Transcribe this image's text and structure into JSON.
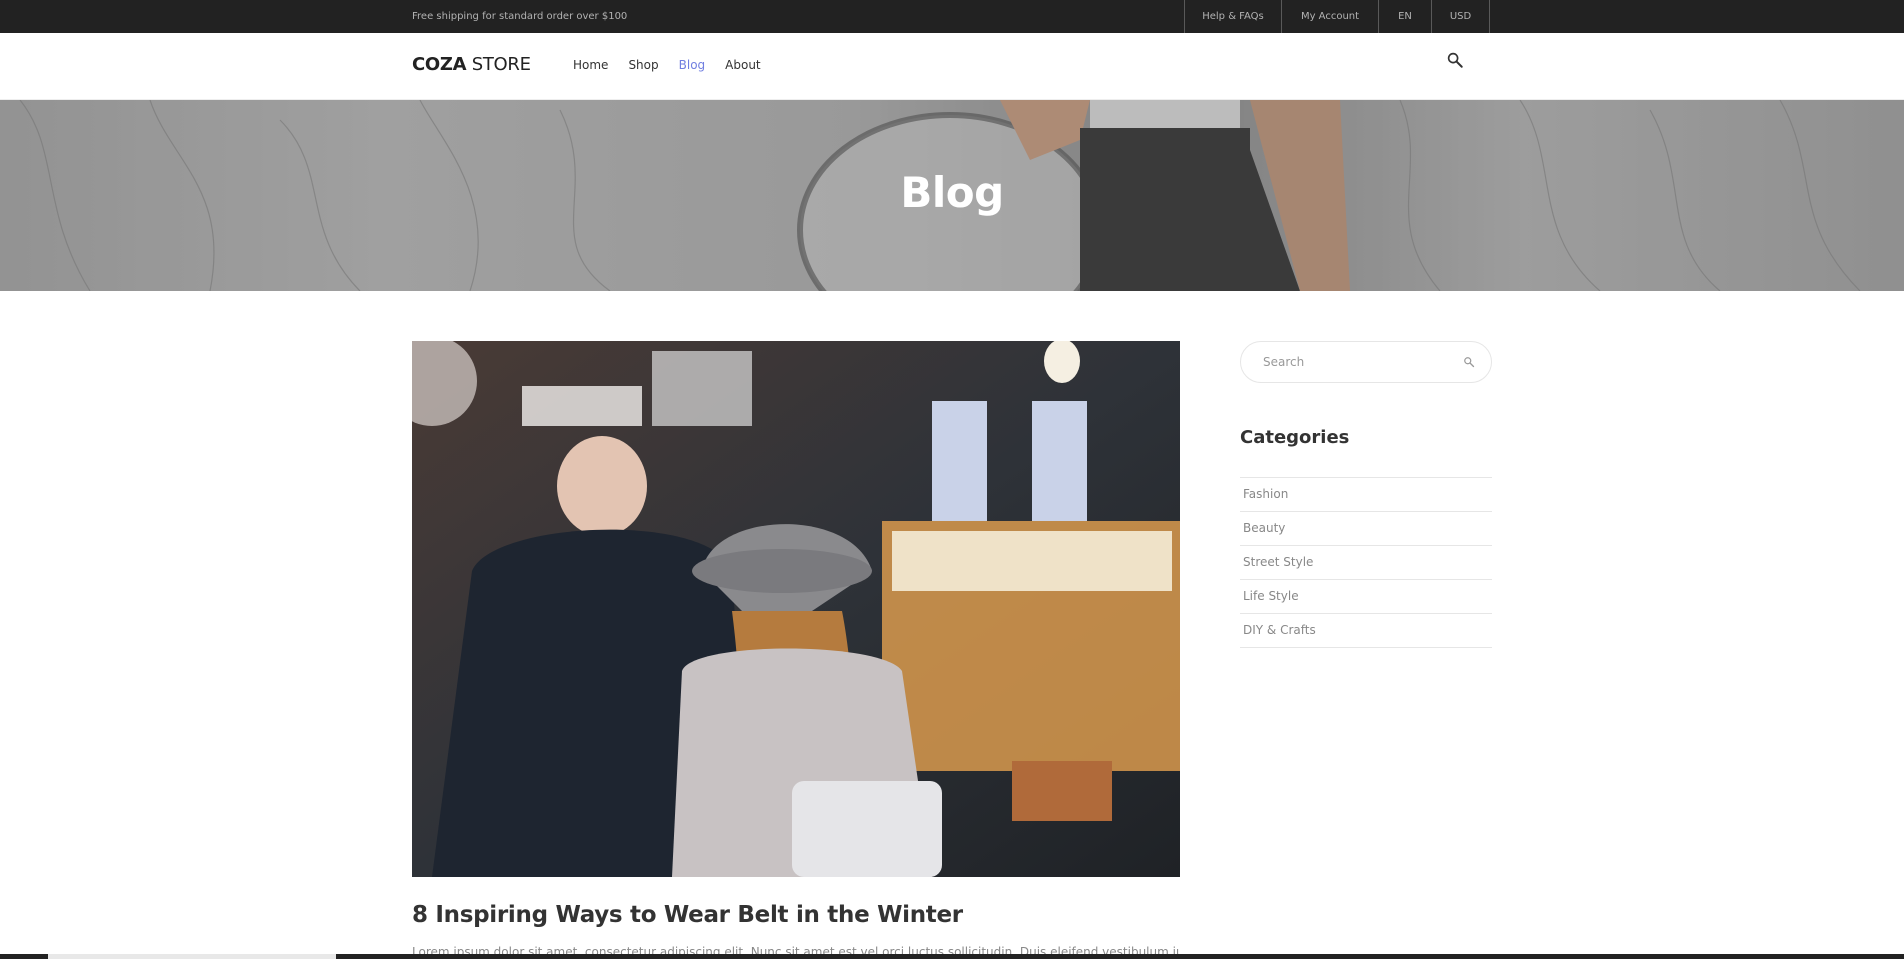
{
  "topbar": {
    "promo": "Free shipping for standard order over $100",
    "links": [
      "Help & FAQs",
      "My Account",
      "EN",
      "USD"
    ]
  },
  "header": {
    "logo_bold": "COZA",
    "logo_light": "STORE",
    "nav": [
      "Home",
      "Shop",
      "Blog",
      "About"
    ],
    "active_nav": "Blog",
    "search_icon": "search-icon"
  },
  "hero": {
    "title": "Blog"
  },
  "post": {
    "title": "8 Inspiring Ways to Wear Belt in the Winter",
    "excerpt": "Lorem ipsum dolor sit amet, consectetur adipiscing elit. Nunc sit amet est vel orci luctus sollicitudin. Duis eleifend vestibulum justo"
  },
  "sidebar": {
    "search_placeholder": "Search",
    "categories_title": "Categories",
    "categories": [
      "Fashion",
      "Beauty",
      "Street Style",
      "Life Style",
      "DIY & Crafts"
    ]
  },
  "colors": {
    "accent": "#717fe0",
    "topbar": "#222222"
  }
}
